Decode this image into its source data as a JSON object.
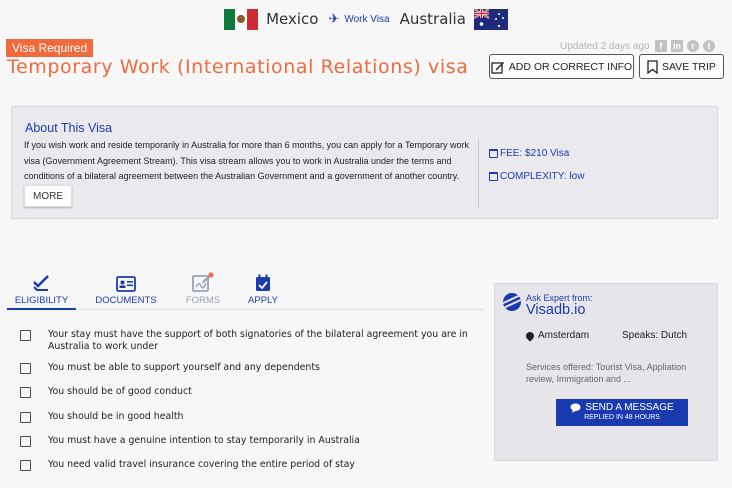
{
  "route": {
    "from_country": "Mexico",
    "via_label": "Work Visa",
    "to_country": "Australia"
  },
  "header": {
    "badge": "Visa Required",
    "title": "Temporary Work (International Relations) visa",
    "updated": "Updated 2 days ago",
    "add_button": "ADD OR CORRECT INFO",
    "save_button": "SAVE TRIP"
  },
  "about": {
    "heading": "About This Visa",
    "text": "If you wish work and reside temporarily in Australia for more than 6 months, you can apply for a Temporary work visa (Government Agreement Stream). This visa stream allows you to work in Australia under the terms and conditions of a bilateral agreement between the Australian Government and a government of another country.",
    "more_button": "MORE",
    "fee": "FEE: $210 Visa",
    "complexity": "COMPLEXITY: low"
  },
  "tabs": [
    {
      "label": "ELIGIBILITY"
    },
    {
      "label": "DOCUMENTS"
    },
    {
      "label": "FORMS"
    },
    {
      "label": "APPLY"
    }
  ],
  "checklist": [
    "Your stay must have the support of both signatories of the bilateral agreement you are in Australia to work under",
    "You must be able to support yourself and any dependents",
    "You should be of good conduct",
    "You should be in good health",
    "You must have a genuine intention to stay temporarily in Australia",
    "You need valid travel insurance covering the entire period of stay"
  ],
  "expert": {
    "ask_label": "Ask Expert from:",
    "name": "Visadb.io",
    "location": "Amsterdam",
    "speaks": "Speaks: Dutch",
    "services": "Services offered: Tourist Visa, Appliation review, Immigration and ...",
    "send_button": "SEND A MESSAGE",
    "send_sub": "REPLIED IN 48 HOURS"
  },
  "colors": {
    "accent": "#1a3bb0",
    "brand_orange": "#f06a3d"
  }
}
